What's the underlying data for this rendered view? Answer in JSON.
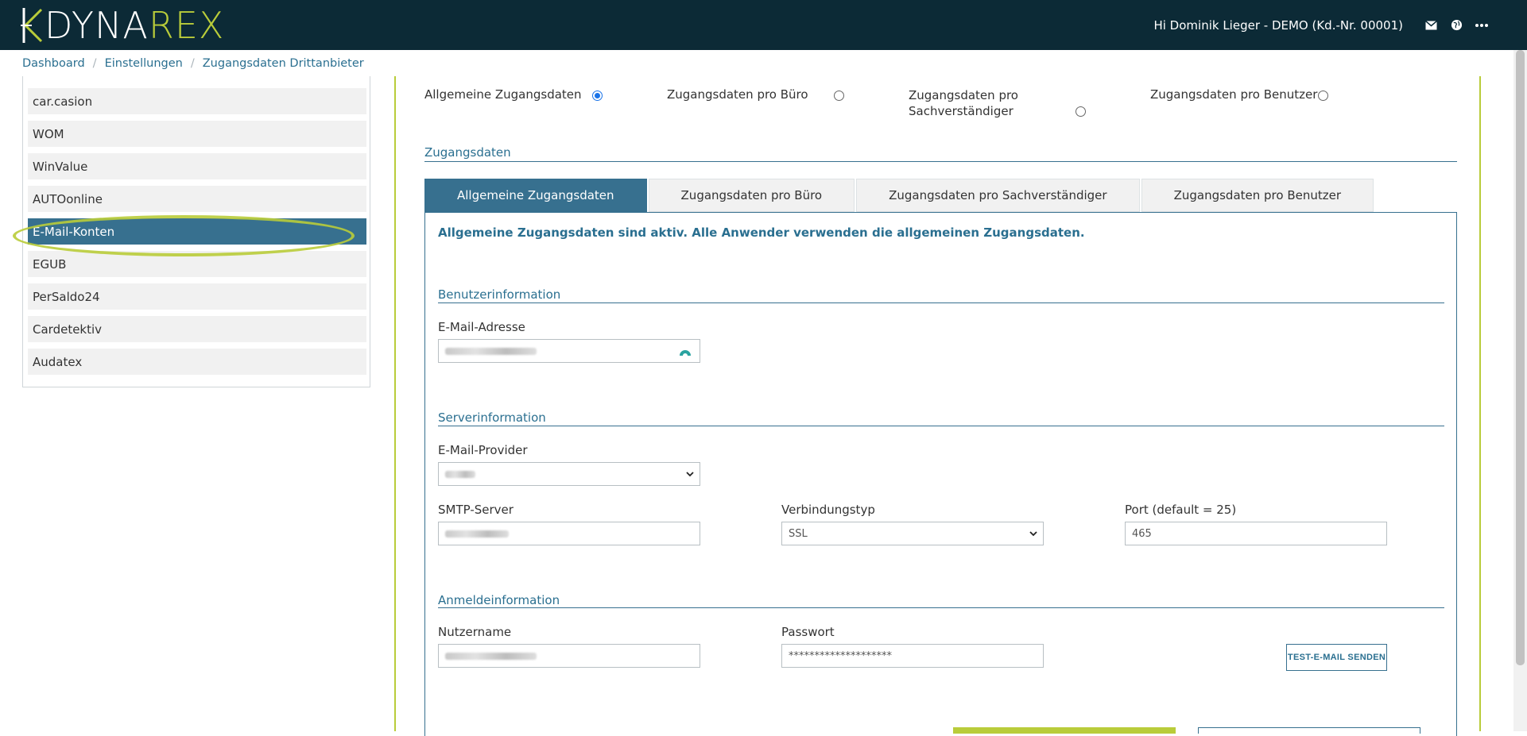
{
  "header": {
    "logo_left": "DYNA",
    "logo_right": "REX",
    "greeting": "Hi Dominik Lieger - DEMO (Kd.-Nr. 00001)",
    "icons": [
      "mail-icon",
      "globe-icon",
      "more-icon"
    ]
  },
  "breadcrumb": {
    "items": [
      "Dashboard",
      "Einstellungen",
      "Zugangsdaten Drittanbieter"
    ]
  },
  "sidebar": {
    "items": [
      {
        "label": "car.casion"
      },
      {
        "label": "WOM"
      },
      {
        "label": "WinValue"
      },
      {
        "label": "AUTOonline"
      },
      {
        "label": "E-Mail-Konten",
        "active": true
      },
      {
        "label": "EGUB"
      },
      {
        "label": "PerSaldo24"
      },
      {
        "label": "Cardetektiv"
      },
      {
        "label": "Audatex"
      }
    ]
  },
  "modes": [
    {
      "label": "Allgemeine Zugangsdaten",
      "checked": true
    },
    {
      "label": "Zugangsdaten pro Büro",
      "checked": false
    },
    {
      "label_line1": "Zugangsdaten pro",
      "label_line2": "Sachverständiger",
      "checked": false
    },
    {
      "label": "Zugangsdaten pro Benutzer",
      "checked": false
    }
  ],
  "section_zugangsdaten": "Zugangsdaten",
  "tabs": [
    {
      "label": "Allgemeine Zugangsdaten",
      "active": true
    },
    {
      "label": "Zugangsdaten pro Büro"
    },
    {
      "label": "Zugangsdaten pro Sachverständiger"
    },
    {
      "label": "Zugangsdaten pro Benutzer"
    }
  ],
  "content": {
    "info": "Allgemeine Zugangsdaten sind aktiv. Alle Anwender verwenden die allgemeinen Zugangsdaten.",
    "benutzer_section": "Benutzerinformation",
    "email_label": "E-Mail-Adresse",
    "server_section": "Serverinformation",
    "provider_label": "E-Mail-Provider",
    "smtp_label": "SMTP-Server",
    "verbindung_label": "Verbindungstyp",
    "verbindung_value": "SSL",
    "port_label": "Port (default = 25)",
    "port_value": "465",
    "anmelde_section": "Anmeldeinformation",
    "nutzer_label": "Nutzername",
    "passwort_label": "Passwort",
    "passwort_value": "********************",
    "test_button": "TEST-E-MAIL SENDEN"
  }
}
